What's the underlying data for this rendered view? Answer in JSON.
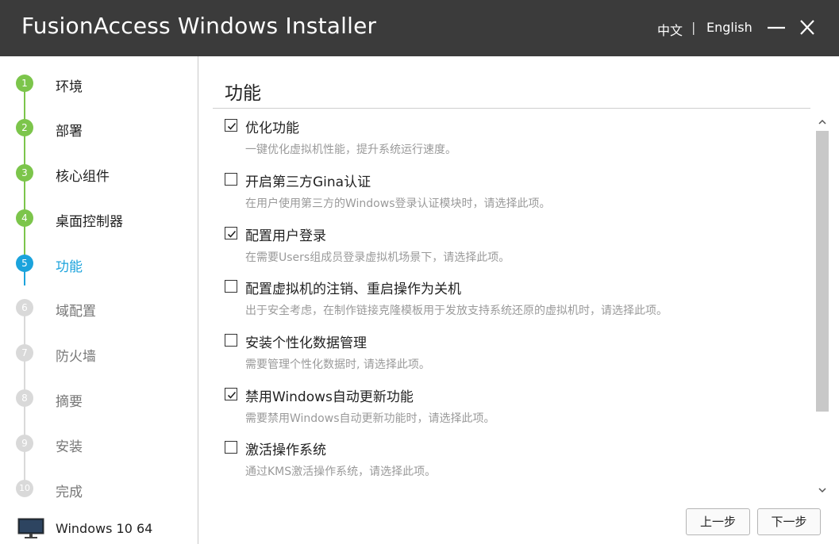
{
  "app": {
    "title": "FusionAccess Windows Installer",
    "lang_zh": "中文",
    "lang_sep": "|",
    "lang_en": "English"
  },
  "colors": {
    "titlebar": "#3b3b3b",
    "done": "#7cc54b",
    "active": "#1ba3dc",
    "pending": "#d9d9d9"
  },
  "sidebar": {
    "steps": [
      {
        "num": "1",
        "label": "环境",
        "state": "done"
      },
      {
        "num": "2",
        "label": "部署",
        "state": "done"
      },
      {
        "num": "3",
        "label": "核心组件",
        "state": "done"
      },
      {
        "num": "4",
        "label": "桌面控制器",
        "state": "done"
      },
      {
        "num": "5",
        "label": "功能",
        "state": "active"
      },
      {
        "num": "6",
        "label": "域配置",
        "state": "pending"
      },
      {
        "num": "7",
        "label": "防火墙",
        "state": "pending"
      },
      {
        "num": "8",
        "label": "摘要",
        "state": "pending"
      },
      {
        "num": "9",
        "label": "安装",
        "state": "pending"
      },
      {
        "num": "10",
        "label": "完成",
        "state": "pending"
      }
    ],
    "os_icon": "monitor-icon",
    "os_label": "Windows 10 64"
  },
  "main": {
    "title": "功能",
    "options": [
      {
        "title": "优化功能",
        "desc": "一键优化虚拟机性能，提升系统运行速度。",
        "checked": true
      },
      {
        "title": "开启第三方Gina认证",
        "desc": "在用户使用第三方的Windows登录认证模块时，请选择此项。",
        "checked": false
      },
      {
        "title": "配置用户登录",
        "desc": "在需要Users组成员登录虚拟机场景下，请选择此项。",
        "checked": true
      },
      {
        "title": "配置虚拟机的注销、重启操作为关机",
        "desc": "出于安全考虑，在制作链接克隆模板用于发放支持系统还原的虚拟机时，请选择此项。",
        "checked": false
      },
      {
        "title": "安装个性化数据管理",
        "desc": "需要管理个性化数据时, 请选择此项。",
        "checked": false
      },
      {
        "title": "禁用Windows自动更新功能",
        "desc": "需要禁用Windows自动更新功能时，请选择此项。",
        "checked": true
      },
      {
        "title": "激活操作系统",
        "desc": "通过KMS激活操作系统，请选择此项。",
        "checked": false
      }
    ]
  },
  "footer": {
    "prev_label": "上一步",
    "next_label": "下一步"
  }
}
